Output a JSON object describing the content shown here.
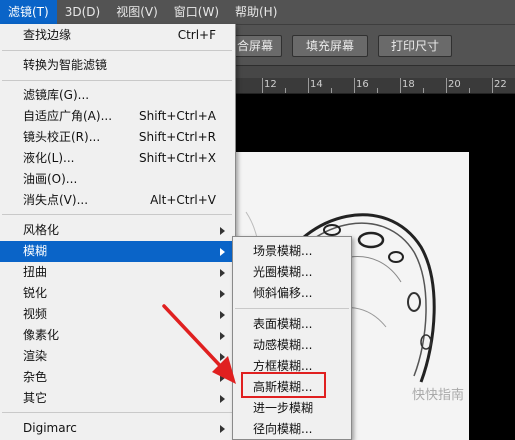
{
  "menubar": {
    "items": [
      {
        "label": "滤镜(T)",
        "active": true
      },
      {
        "label": "3D(D)"
      },
      {
        "label": "视图(V)"
      },
      {
        "label": "窗口(W)"
      },
      {
        "label": "帮助(H)"
      }
    ]
  },
  "options_bar": {
    "buttons": [
      "合屏幕",
      "填充屏幕",
      "打印尺寸"
    ]
  },
  "ruler": {
    "numbers": [
      "12",
      "14",
      "16",
      "18",
      "20",
      "22"
    ]
  },
  "filter_menu": {
    "items": [
      {
        "label": "查找边缘",
        "shortcut": "Ctrl+F"
      },
      {
        "label": "转换为智能滤镜"
      },
      {
        "label": "滤镜库(G)..."
      },
      {
        "label": "自适应广角(A)...",
        "shortcut": "Shift+Ctrl+A"
      },
      {
        "label": "镜头校正(R)...",
        "shortcut": "Shift+Ctrl+R"
      },
      {
        "label": "液化(L)...",
        "shortcut": "Shift+Ctrl+X"
      },
      {
        "label": "油画(O)..."
      },
      {
        "label": "消失点(V)...",
        "shortcut": "Alt+Ctrl+V"
      },
      {
        "label": "风格化"
      },
      {
        "label": "模糊",
        "highlighted": true
      },
      {
        "label": "扭曲"
      },
      {
        "label": "锐化"
      },
      {
        "label": "视频"
      },
      {
        "label": "像素化"
      },
      {
        "label": "渲染"
      },
      {
        "label": "杂色"
      },
      {
        "label": "其它"
      },
      {
        "label": "Digimarc"
      }
    ]
  },
  "blur_submenu": {
    "items": [
      {
        "label": "场景模糊..."
      },
      {
        "label": "光圈模糊..."
      },
      {
        "label": "倾斜偏移..."
      },
      {
        "label": "表面模糊..."
      },
      {
        "label": "动感模糊..."
      },
      {
        "label": "方框模糊..."
      },
      {
        "label": "高斯模糊...",
        "emphasized": true
      },
      {
        "label": "进一步模糊"
      },
      {
        "label": "径向模糊..."
      }
    ]
  },
  "watermark": "快快指南",
  "colors": {
    "highlight": "#0a64c8",
    "annotation": "#e02020"
  }
}
